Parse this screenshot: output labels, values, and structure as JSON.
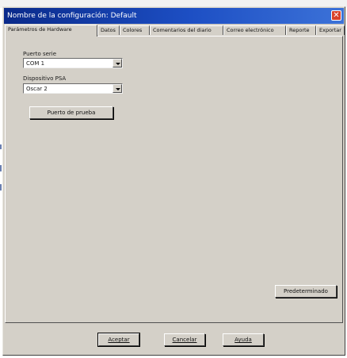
{
  "window": {
    "title": "Nombre de la configuración: Default",
    "close_glyph": "✕"
  },
  "tabs": [
    {
      "label": "Parámetros de Hardware",
      "active": true
    },
    {
      "label": "Datos",
      "active": false
    },
    {
      "label": "Colores",
      "active": false
    },
    {
      "label": "Comentarios del diario",
      "active": false
    },
    {
      "label": "Correo electrónico",
      "active": false
    },
    {
      "label": "Reporte",
      "active": false
    },
    {
      "label": "Exportar",
      "active": false
    }
  ],
  "hardware": {
    "port_label": "Puerto serie",
    "port_value": "COM 1",
    "device_label": "Dispositivo PSA",
    "device_value": "Oscar 2",
    "test_button": "Puerto de prueba",
    "defaults_button": "Predeterminado"
  },
  "footer": {
    "accept": "Aceptar",
    "cancel": "Cancelar",
    "help": "Ayuda"
  },
  "colors": {
    "titlebar_start": "#0a2a8a",
    "titlebar_end": "#3c72d8",
    "dialog_face": "#d4d0c8",
    "close_button": "#d8422b"
  },
  "icons": {
    "close": "close-icon",
    "dropdown": "chevron-down-icon"
  }
}
